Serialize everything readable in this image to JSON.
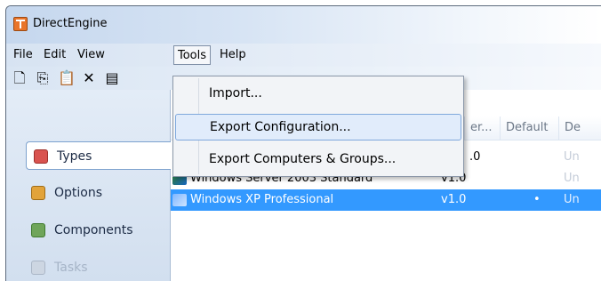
{
  "window": {
    "title": "DirectEngine"
  },
  "menubar": {
    "items": [
      "File",
      "Edit",
      "View",
      "Tools",
      "Help"
    ]
  },
  "toolbar": {
    "icons": [
      "new-icon",
      "copy-icon",
      "paste-icon",
      "delete-icon",
      "properties-icon"
    ],
    "glyphs": [
      "🗋",
      "⎘",
      "📋",
      "✕",
      "▤"
    ]
  },
  "dropdown": {
    "items": [
      "Import...",
      "Export Configuration...",
      "Export Computers & Groups..."
    ],
    "hovered_index": 1
  },
  "nav": {
    "items": [
      "Types",
      "Options",
      "Components",
      "Tasks"
    ],
    "selected": "Types"
  },
  "list": {
    "columns": [
      "er...",
      "Default",
      "De"
    ],
    "rows": [
      {
        "name": "",
        "version": ".0",
        "default": "",
        "desc": "Un"
      },
      {
        "name": "Windows Server 2003 Standard",
        "version": "v1.0",
        "default": "",
        "desc": "Un"
      },
      {
        "name": "Windows XP Professional",
        "version": "v1.0",
        "default": "•",
        "desc": "Un",
        "selected": true
      }
    ]
  }
}
